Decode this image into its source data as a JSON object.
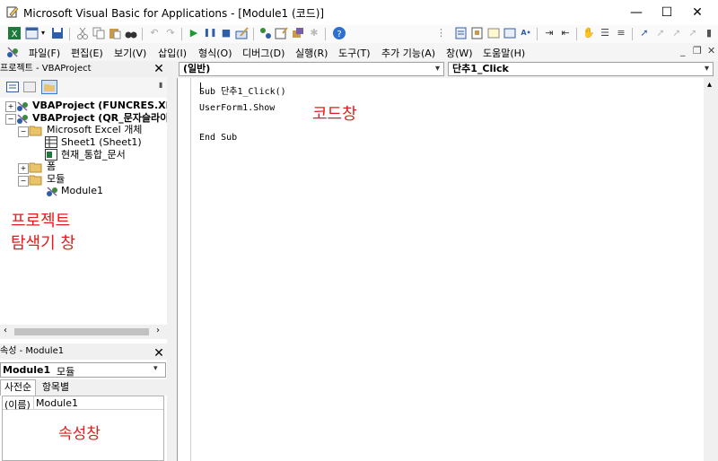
{
  "window": {
    "title": "Microsoft Visual Basic for Applications - [Module1 (코드)]",
    "minimize": "—",
    "maximize": "☐",
    "close": "✕"
  },
  "menu": {
    "items": [
      "파일(F)",
      "편집(E)",
      "보기(V)",
      "삽입(I)",
      "형식(O)",
      "디버그(D)",
      "실행(R)",
      "도구(T)",
      "추가 기능(A)",
      "창(W)",
      "도움말(H)"
    ],
    "mdi_min": "_",
    "mdi_restore": "❐",
    "mdi_close": "✕"
  },
  "project_panel": {
    "title": "프로젝트 - VBAProject",
    "close": "✕",
    "tree": [
      {
        "label": "VBAProject (FUNCRES.XLA",
        "bold": true
      },
      {
        "label": "VBAProject (QR_문자슬라이",
        "bold": true
      },
      {
        "label": "Microsoft Excel 개체"
      },
      {
        "label": "Sheet1 (Sheet1)"
      },
      {
        "label": "현재_통합_문서"
      },
      {
        "label": "폼"
      },
      {
        "label": "모듈"
      },
      {
        "label": "Module1"
      }
    ],
    "annotation_line1": "프로젝트",
    "annotation_line2": "탐색기 창"
  },
  "properties_panel": {
    "title": "속성 - Module1",
    "close": "✕",
    "object_name": "Module1",
    "object_type": "모듈",
    "tabs": [
      "사전순",
      "항목별"
    ],
    "prop_name": "(이름)",
    "prop_value": "Module1",
    "annotation": "속성창"
  },
  "code_window": {
    "object_combo": "(일반)",
    "procedure_combo": "단추1_Click",
    "lines": [
      "Sub 단추1_Click()",
      "UserForm1.Show",
      "End Sub"
    ],
    "annotation": "코드창"
  },
  "colors": {
    "annotation": "#e41b1b",
    "title_bar": "#ffffff",
    "panel_header": "#f0f0f0"
  }
}
